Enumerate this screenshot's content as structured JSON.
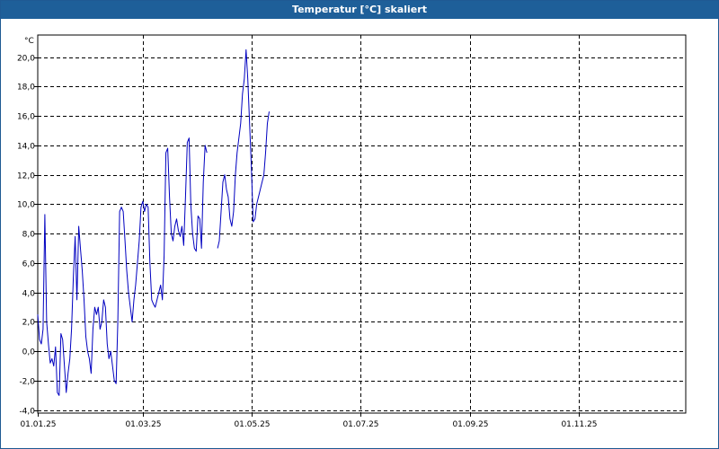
{
  "window": {
    "title": "Temperatur [°C] skaliert"
  },
  "colors": {
    "titlebar": "#1e5f99",
    "series": "#0000c0",
    "grid": "#000000"
  },
  "chart_data": {
    "type": "line",
    "title": "Temperatur [°C] skaliert",
    "ylabel": "°C",
    "xlabel": "",
    "x_type": "date",
    "xlim": [
      "2025-01-01",
      "2025-12-31"
    ],
    "ylim": [
      -4.2,
      21.5
    ],
    "grid": true,
    "grid_style": "dashed",
    "x_ticks": [
      {
        "date": "2025-01-01",
        "label": "01.01.25"
      },
      {
        "date": "2025-03-01",
        "label": "01.03.25"
      },
      {
        "date": "2025-05-01",
        "label": "01.05.25"
      },
      {
        "date": "2025-07-01",
        "label": "01.07.25"
      },
      {
        "date": "2025-09-01",
        "label": "01.09.25"
      },
      {
        "date": "2025-11-01",
        "label": "01.11.25"
      }
    ],
    "y_ticks": [
      {
        "value": 20,
        "label": "20,0"
      },
      {
        "value": 18,
        "label": "18,0"
      },
      {
        "value": 16,
        "label": "16,0"
      },
      {
        "value": 14,
        "label": "14,0"
      },
      {
        "value": 12,
        "label": "12,0"
      },
      {
        "value": 10,
        "label": "10,0"
      },
      {
        "value": 8,
        "label": "8,0"
      },
      {
        "value": 6,
        "label": "6,0"
      },
      {
        "value": 4,
        "label": "4,0"
      },
      {
        "value": 2,
        "label": "2,0"
      },
      {
        "value": 0,
        "label": "0,0"
      },
      {
        "value": -2,
        "label": "-2,0"
      },
      {
        "value": -4,
        "label": "-4,0"
      }
    ],
    "series": [
      {
        "segments": [
          [
            [
              "2025-01-01",
              2.5
            ],
            [
              "2025-01-02",
              0.8
            ],
            [
              "2025-01-03",
              0.5
            ],
            [
              "2025-01-04",
              1.5
            ],
            [
              "2025-01-05",
              9.3
            ],
            [
              "2025-01-06",
              2.0
            ],
            [
              "2025-01-07",
              0.5
            ],
            [
              "2025-01-08",
              -0.8
            ],
            [
              "2025-01-09",
              -0.5
            ],
            [
              "2025-01-10",
              -1.0
            ],
            [
              "2025-01-11",
              0.3
            ],
            [
              "2025-01-12",
              -2.8
            ],
            [
              "2025-01-13",
              -3.0
            ],
            [
              "2025-01-14",
              1.2
            ],
            [
              "2025-01-15",
              0.8
            ],
            [
              "2025-01-16",
              -1.0
            ],
            [
              "2025-01-17",
              -2.8
            ],
            [
              "2025-01-18",
              -1.5
            ],
            [
              "2025-01-19",
              -0.5
            ],
            [
              "2025-01-20",
              1.5
            ],
            [
              "2025-01-21",
              5.0
            ],
            [
              "2025-01-22",
              7.8
            ],
            [
              "2025-01-23",
              3.5
            ],
            [
              "2025-01-24",
              8.5
            ],
            [
              "2025-01-25",
              7.0
            ],
            [
              "2025-01-26",
              5.5
            ],
            [
              "2025-01-27",
              3.5
            ],
            [
              "2025-01-28",
              1.0
            ],
            [
              "2025-01-29",
              0.0
            ],
            [
              "2025-01-30",
              -0.5
            ],
            [
              "2025-01-31",
              -1.5
            ],
            [
              "2025-02-01",
              1.5
            ],
            [
              "2025-02-02",
              3.0
            ],
            [
              "2025-02-03",
              2.5
            ],
            [
              "2025-02-04",
              3.0
            ],
            [
              "2025-02-05",
              1.5
            ],
            [
              "2025-02-06",
              2.0
            ],
            [
              "2025-02-07",
              3.5
            ],
            [
              "2025-02-08",
              3.0
            ],
            [
              "2025-02-09",
              0.5
            ],
            [
              "2025-02-10",
              -0.5
            ],
            [
              "2025-02-11",
              0.0
            ],
            [
              "2025-02-12",
              -1.0
            ],
            [
              "2025-02-13",
              -2.0
            ],
            [
              "2025-02-14",
              -2.2
            ],
            [
              "2025-02-15",
              2.0
            ],
            [
              "2025-02-16",
              9.5
            ],
            [
              "2025-02-17",
              9.8
            ],
            [
              "2025-02-18",
              9.5
            ],
            [
              "2025-02-19",
              7.5
            ],
            [
              "2025-02-20",
              5.5
            ],
            [
              "2025-02-21",
              4.0
            ],
            [
              "2025-02-22",
              3.0
            ],
            [
              "2025-02-23",
              2.0
            ],
            [
              "2025-02-24",
              3.5
            ],
            [
              "2025-02-25",
              4.5
            ],
            [
              "2025-02-26",
              6.0
            ],
            [
              "2025-02-27",
              7.5
            ],
            [
              "2025-02-28",
              9.8
            ],
            [
              "2025-03-01",
              10.2
            ],
            [
              "2025-03-02",
              9.5
            ],
            [
              "2025-03-03",
              10.0
            ],
            [
              "2025-03-04",
              9.8
            ],
            [
              "2025-03-05",
              6.0
            ],
            [
              "2025-03-06",
              3.5
            ],
            [
              "2025-03-07",
              3.2
            ],
            [
              "2025-03-08",
              3.0
            ],
            [
              "2025-03-09",
              3.5
            ],
            [
              "2025-03-10",
              4.0
            ],
            [
              "2025-03-11",
              4.5
            ],
            [
              "2025-03-12",
              3.5
            ],
            [
              "2025-03-13",
              6.5
            ],
            [
              "2025-03-14",
              13.5
            ],
            [
              "2025-03-15",
              13.8
            ],
            [
              "2025-03-16",
              10.5
            ],
            [
              "2025-03-17",
              8.0
            ],
            [
              "2025-03-18",
              7.5
            ],
            [
              "2025-03-19",
              8.5
            ],
            [
              "2025-03-20",
              9.0
            ],
            [
              "2025-03-21",
              8.2
            ],
            [
              "2025-03-22",
              7.8
            ],
            [
              "2025-03-23",
              8.5
            ],
            [
              "2025-03-24",
              7.2
            ],
            [
              "2025-03-25",
              10.5
            ],
            [
              "2025-03-26",
              14.2
            ],
            [
              "2025-03-27",
              14.5
            ],
            [
              "2025-03-28",
              10.0
            ],
            [
              "2025-03-29",
              8.0
            ],
            [
              "2025-03-30",
              7.0
            ],
            [
              "2025-03-31",
              6.8
            ],
            [
              "2025-04-01",
              9.2
            ],
            [
              "2025-04-02",
              9.0
            ],
            [
              "2025-04-03",
              7.0
            ],
            [
              "2025-04-04",
              11.5
            ],
            [
              "2025-04-05",
              14.0
            ],
            [
              "2025-04-06",
              13.5
            ]
          ],
          [
            [
              "2025-04-12",
              7.0
            ],
            [
              "2025-04-13",
              7.5
            ],
            [
              "2025-04-14",
              9.5
            ],
            [
              "2025-04-15",
              11.5
            ],
            [
              "2025-04-16",
              12.0
            ],
            [
              "2025-04-17",
              11.0
            ],
            [
              "2025-04-18",
              10.5
            ],
            [
              "2025-04-19",
              9.0
            ],
            [
              "2025-04-20",
              8.5
            ],
            [
              "2025-04-21",
              9.5
            ],
            [
              "2025-04-22",
              12.0
            ],
            [
              "2025-04-23",
              13.5
            ],
            [
              "2025-04-24",
              14.5
            ],
            [
              "2025-04-25",
              15.5
            ],
            [
              "2025-04-26",
              17.5
            ],
            [
              "2025-04-27",
              18.5
            ],
            [
              "2025-04-28",
              20.5
            ],
            [
              "2025-04-29",
              18.5
            ],
            [
              "2025-04-30",
              15.5
            ],
            [
              "2025-05-01",
              12.5
            ],
            [
              "2025-05-02",
              8.8
            ],
            [
              "2025-05-03",
              9.0
            ],
            [
              "2025-05-04",
              10.0
            ],
            [
              "2025-05-05",
              10.5
            ],
            [
              "2025-05-06",
              11.0
            ],
            [
              "2025-05-07",
              11.5
            ],
            [
              "2025-05-08",
              12.0
            ],
            [
              "2025-05-09",
              13.5
            ],
            [
              "2025-05-10",
              15.5
            ],
            [
              "2025-05-11",
              16.3
            ]
          ]
        ]
      }
    ]
  }
}
